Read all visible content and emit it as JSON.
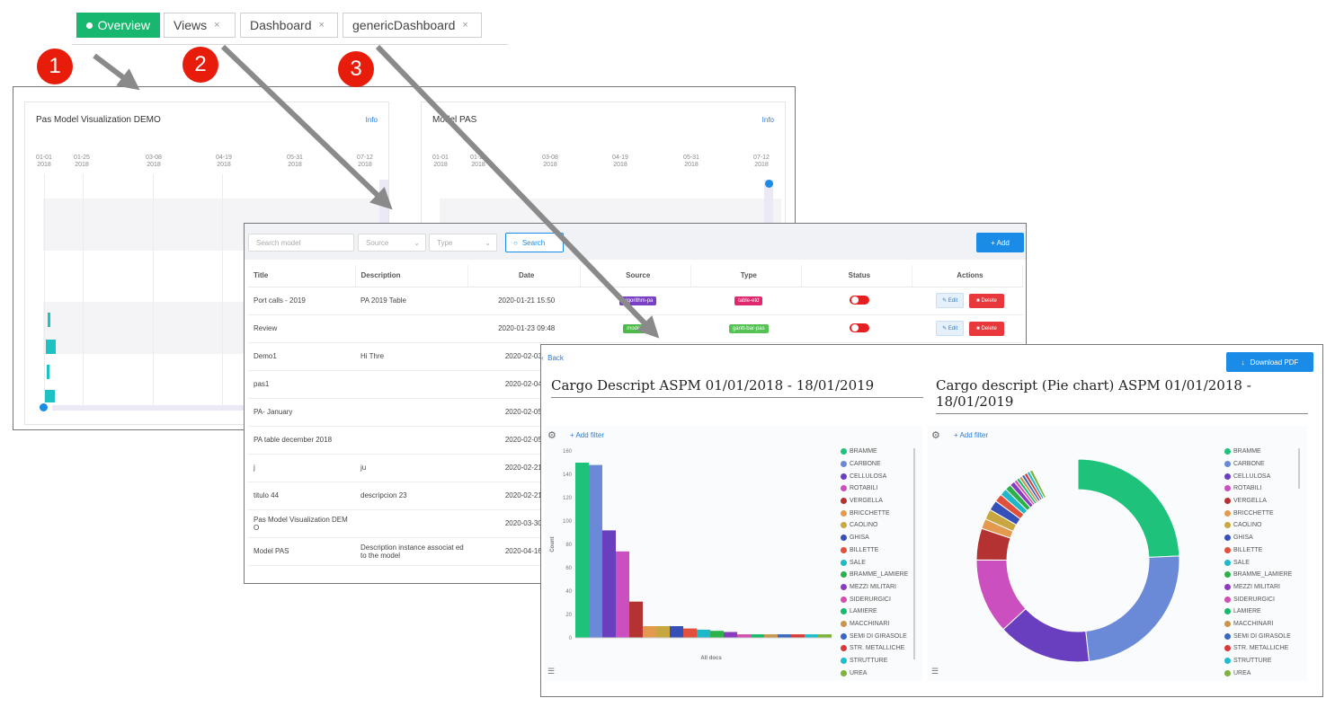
{
  "tabs": {
    "overview": "Overview",
    "views": "Views",
    "dashboard": "Dashboard",
    "generic": "genericDashboard",
    "close": "×"
  },
  "badges": [
    "1",
    "2",
    "3"
  ],
  "panelA": {
    "card1": {
      "title": "Pas Model Visualization DEMO",
      "info": "Info"
    },
    "card2": {
      "title": "Model PAS",
      "info": "Info"
    },
    "dates1": [
      "01-01\n2018",
      "01-25\n2018",
      "03-08\n2018",
      "04-19\n2018",
      "05-31\n2018",
      "07-12\n2018"
    ],
    "dates2": [
      "01-01\n2018",
      "01-25\n2018",
      "03-08\n2018",
      "04-19\n2018",
      "05-31\n2018",
      "07-12\n2018"
    ]
  },
  "panelB": {
    "search_placeholder": "Search model",
    "source_placeholder": "Source",
    "type_placeholder": "Type",
    "search_button": "Search",
    "add_button": "+ Add",
    "columns": [
      "Title",
      "Description",
      "Date",
      "Source",
      "Type",
      "Status",
      "Actions"
    ],
    "rows": [
      {
        "title": "Port calls - 2019",
        "desc": "PA 2019 Table",
        "date": "2020-01-21 15:50",
        "source": "algorithm-pa",
        "type": "table-etd"
      },
      {
        "title": "Review",
        "desc": "",
        "date": "2020-01-23 09:48",
        "source": "model-pa",
        "type": "gantt-bar-pas"
      },
      {
        "title": "Demo1",
        "desc": "Hi Thre",
        "date": "2020-02-03 1"
      },
      {
        "title": "pas1",
        "desc": "",
        "date": "2020-02-04 1"
      },
      {
        "title": "PA- January",
        "desc": "",
        "date": "2020-02-05 1"
      },
      {
        "title": "PA table december 2018",
        "desc": "",
        "date": "2020-02-05 1"
      },
      {
        "title": "j",
        "desc": "ju",
        "date": "2020-02-21 1"
      },
      {
        "title": "titulo 44",
        "desc": "descripcion 23",
        "date": "2020-02-21 1"
      },
      {
        "title": "Pas Model Visualization DEM O",
        "desc": "",
        "date": "2020-03-30 1"
      },
      {
        "title": "Model PAS",
        "desc": "Description instance associat ed to the model",
        "date": "2020-04-16 1"
      }
    ],
    "edit_label": "Edit",
    "delete_label": "Delete"
  },
  "panelC": {
    "back": "Back",
    "download": "Download PDF",
    "add_filter": "+ Add filter",
    "bar_title": "Cargo Descript ASPM 01/01/2018 - 18/01/2019",
    "pie_title": "Cargo descript (Pie chart) ASPM 01/01/2018 - 18/01/2019",
    "legend": [
      "BRAMME",
      "CARBONE",
      "CELLULOSA",
      "ROTABILI",
      "VERGELLA",
      "BRICCHETTE",
      "CAOLINO",
      "GHISA",
      "BILLETTE",
      "SALE",
      "BRAMME_LAMIERE",
      "MEZZI MILITARI",
      "SIDERURGICI",
      "LAMIERE",
      "MACCHINARI",
      "SEMI DI GIRASOLE",
      "STR. METALLICHE",
      "STRUTTURE",
      "UREA"
    ],
    "colors": [
      "#1fc27a",
      "#6a8ad8",
      "#6a3fbf",
      "#cc4fc0",
      "#b43232",
      "#e39a4e",
      "#c8a640",
      "#3550b8",
      "#e0503c",
      "#1fb8c8",
      "#2db04a",
      "#8a3cbf",
      "#d04fb0",
      "#16b86a",
      "#c8964e",
      "#3a68c0",
      "#d83a3a",
      "#1fbccc",
      "#7ab43a"
    ]
  },
  "chart_data": [
    {
      "type": "bar",
      "xlabel": "All docs",
      "ylabel": "Count",
      "ylim": [
        0,
        160
      ],
      "yticks": [
        0,
        20,
        40,
        60,
        80,
        100,
        120,
        140,
        160
      ],
      "categories": [
        "BRAMME",
        "CARBONE",
        "CELLULOSA",
        "ROTABILI",
        "VERGELLA",
        "BRICCHETTE",
        "CAOLINO",
        "GHISA",
        "BILLETTE",
        "SALE",
        "BRAMME_LAMIERE",
        "MEZZI MILITARI",
        "SIDERURGICI",
        "LAMIERE",
        "MACCHINARI",
        "SEMI DI GIRASOLE",
        "STR. METALLICHE",
        "STRUTTURE",
        "UREA"
      ],
      "values": [
        150,
        148,
        92,
        74,
        31,
        10,
        10,
        10,
        8,
        7,
        6,
        5,
        3,
        3,
        3,
        3,
        3,
        3,
        3
      ]
    },
    {
      "type": "pie",
      "donut": true,
      "categories": [
        "BRAMME",
        "CARBONE",
        "CELLULOSA",
        "ROTABILI",
        "VERGELLA",
        "BRICCHETTE",
        "CAOLINO",
        "GHISA",
        "BILLETTE",
        "SALE",
        "BRAMME_LAMIERE",
        "MEZZI MILITARI",
        "SIDERURGICI",
        "LAMIERE",
        "MACCHINARI",
        "SEMI DI GIRASOLE",
        "STR. METALLICHE",
        "STRUTTURE",
        "UREA"
      ],
      "values": [
        150,
        148,
        92,
        74,
        31,
        10,
        10,
        10,
        8,
        7,
        6,
        5,
        3,
        3,
        3,
        3,
        3,
        3,
        3
      ]
    }
  ]
}
